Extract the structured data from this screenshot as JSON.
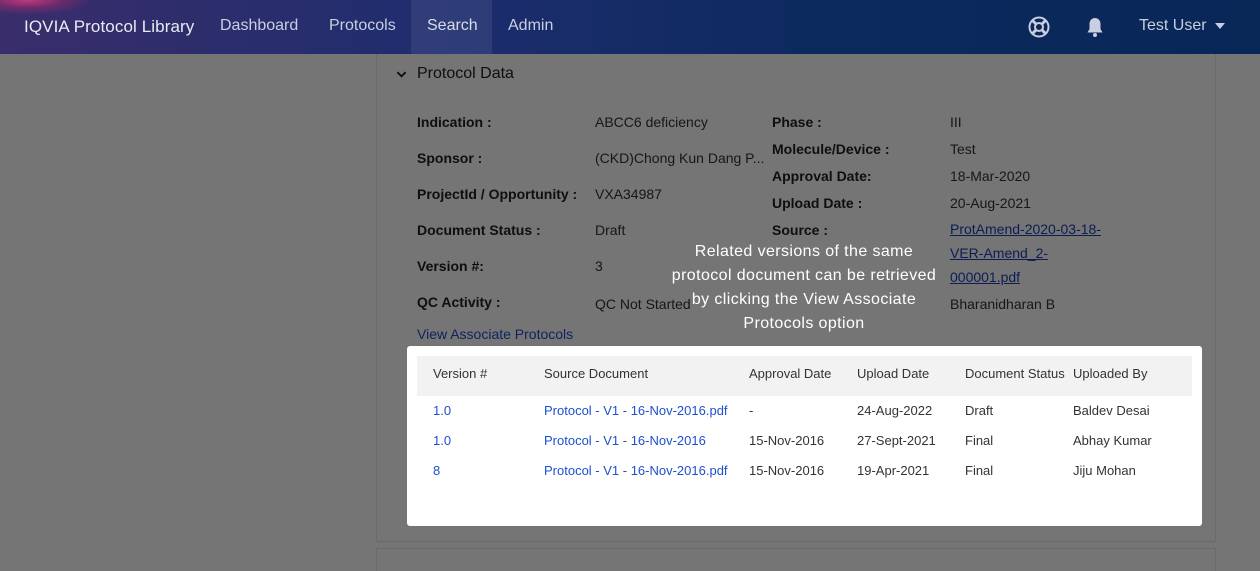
{
  "nav": {
    "brand": "IQVIA Protocol Library",
    "items": [
      "Dashboard",
      "Protocols",
      "Search",
      "Admin"
    ],
    "active": "Search",
    "user": "Test User"
  },
  "section": {
    "title": "Protocol Data"
  },
  "fields_left": [
    {
      "label": "Indication :",
      "value": "ABCC6 deficiency"
    },
    {
      "label": "Sponsor :",
      "value": "(CKD)Chong Kun Dang P..."
    },
    {
      "label": "ProjectId / Opportunity :",
      "value": "VXA34987"
    },
    {
      "label": "Document Status :",
      "value": "Draft"
    },
    {
      "label": "Version #:",
      "value": "3"
    },
    {
      "label": "QC Activity :",
      "value": "QC Not Started"
    }
  ],
  "fields_right": {
    "phase": {
      "label": "Phase :",
      "value": "III"
    },
    "molecule": {
      "label": "Molecule/Device :",
      "value": "Test"
    },
    "approval": {
      "label": "Approval Date:",
      "value": "18-Mar-2020"
    },
    "upload": {
      "label": "Upload Date :",
      "value": "20-Aug-2021"
    },
    "source": {
      "label": "Source :",
      "value_lines": [
        "ProtAmend-2020-03-18-",
        "VER-Amend_2-",
        "000001.pdf"
      ]
    },
    "uploaded_by": {
      "value": "Bharanidharan B"
    }
  },
  "view_associate": "View Associate Protocols",
  "tooltip": "Related versions of the same protocol document can be retrieved by clicking the View Associate Protocols option",
  "table": {
    "headers": [
      "Version #",
      "Source Document",
      "Approval Date",
      "Upload Date",
      "Document Status",
      "Uploaded By"
    ],
    "rows": [
      [
        "1.0",
        "Protocol - V1 - 16-Nov-2016.pdf",
        "-",
        "24-Aug-2022",
        "Draft",
        "Baldev Desai"
      ],
      [
        "1.0",
        "Protocol - V1 - 16-Nov-2016",
        "15-Nov-2016",
        "27-Sept-2021",
        "Final",
        "Abhay Kumar"
      ],
      [
        "8",
        "Protocol - V1 - 16-Nov-2016.pdf",
        "15-Nov-2016",
        "19-Apr-2021",
        "Final",
        "Jiju Mohan"
      ]
    ]
  },
  "icons": {
    "help": "help-lifebuoy-icon",
    "bell": "bell-icon",
    "caret": "caret-down-icon",
    "chevron": "chevron-down-icon"
  }
}
